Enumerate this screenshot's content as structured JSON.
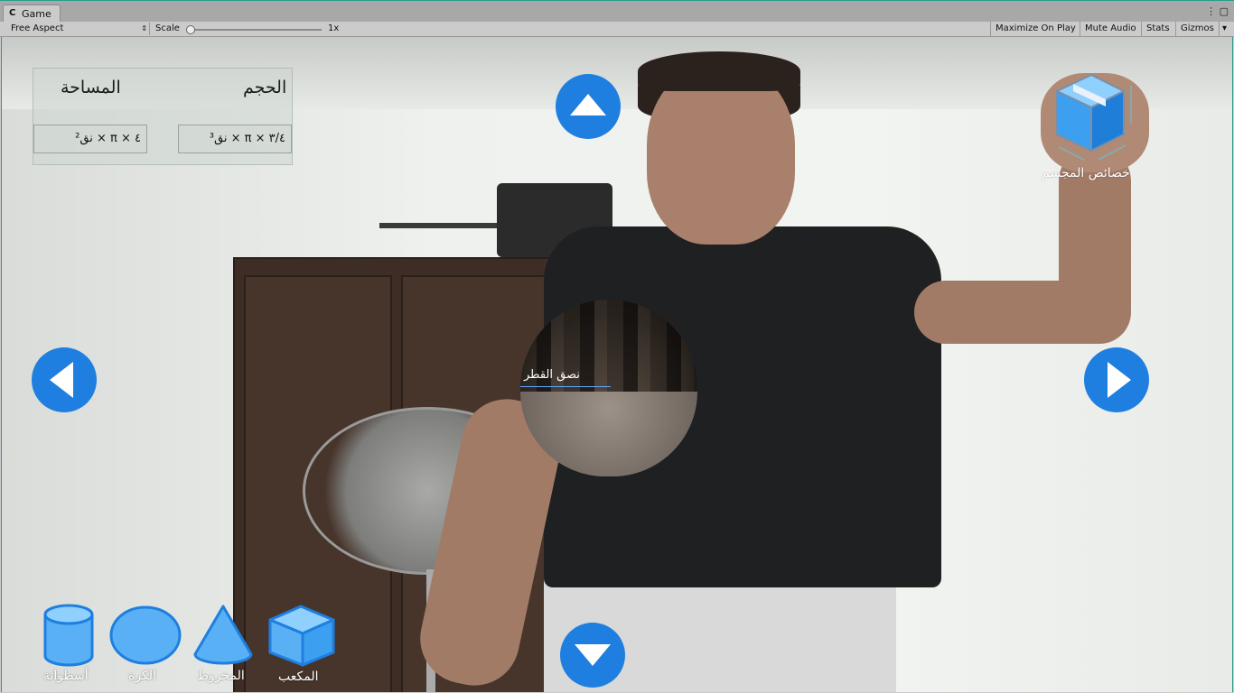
{
  "window": {
    "tab_label": "Game",
    "tab_icon": "unity-logo-icon",
    "controls": "⋮ ▢"
  },
  "toolbar": {
    "aspect": "Free Aspect",
    "scale_label": "Scale",
    "scale_value": "1x",
    "maximize": "Maximize On Play",
    "mute": "Mute Audio",
    "stats": "Stats",
    "gizmos": "Gizmos",
    "gizmos_arrow": "▾"
  },
  "panel": {
    "area_header": "المساحة",
    "volume_header": "الحجم",
    "area_formula": "٤ × π × نق²",
    "volume_formula": "٣/٤ × π × نق³"
  },
  "scene": {
    "radius_label": "نصق القطر"
  },
  "cube_properties": {
    "label": "خصائص المجسم"
  },
  "shapes": [
    {
      "label": "أسطوانة"
    },
    {
      "label": "الكرة"
    },
    {
      "label": "المخروط"
    },
    {
      "label": "المكعب"
    }
  ],
  "colors": {
    "accent": "#1e7fe0",
    "shape_fill": "#5ab0f5",
    "shape_stroke": "#1e7fe0"
  }
}
